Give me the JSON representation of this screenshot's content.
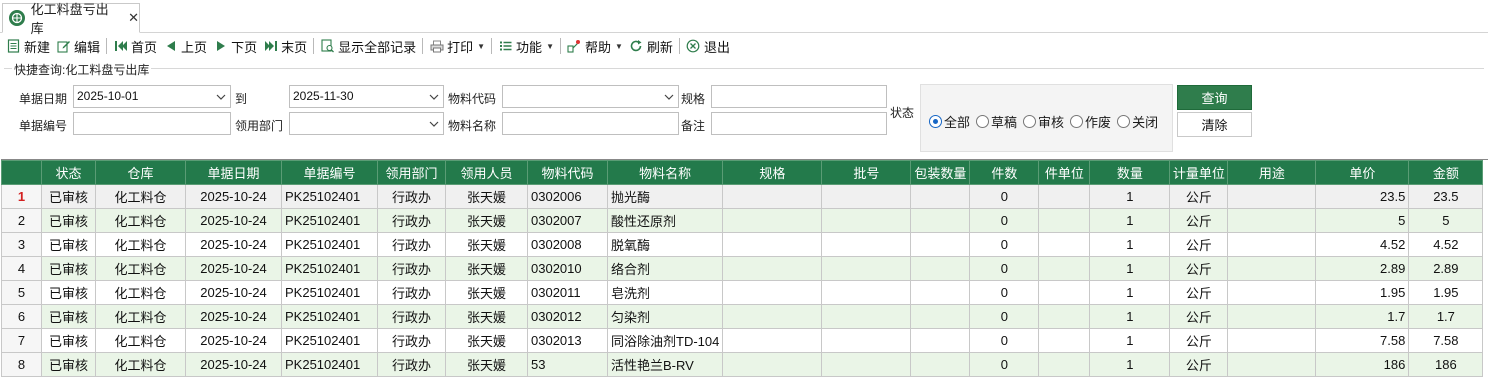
{
  "tab": {
    "label": "化工料盘亏出库",
    "close": "✕"
  },
  "toolbar": {
    "new": "新建",
    "edit": "编辑",
    "first": "首页",
    "prev": "上页",
    "next": "下页",
    "last": "末页",
    "show_all": "显示全部记录",
    "print": "打印",
    "function": "功能",
    "help": "帮助",
    "refresh": "刷新",
    "exit": "退出"
  },
  "query": {
    "title": "快捷查询:化工料盘亏出库",
    "date_label": "单据日期",
    "date_from": "2025-10-01",
    "to_label": "到",
    "date_to": "2025-11-30",
    "material_code_label": "物料代码",
    "material_code": "",
    "spec_label": "规格",
    "spec": "",
    "doc_no_label": "单据编号",
    "doc_no": "",
    "dept_label": "领用部门",
    "dept": "",
    "material_name_label": "物料名称",
    "material_name": "",
    "remark_label": "备注",
    "remark": "",
    "status_label": "状态",
    "status_options": [
      "全部",
      "草稿",
      "审核",
      "作废",
      "关闭"
    ],
    "status_selected": "全部",
    "query_button": "查询",
    "clear_button": "清除"
  },
  "colors": {
    "header_green": "#237a4b",
    "stripe": "#eaf5e7",
    "accent_blue": "#1666c5"
  },
  "grid": {
    "columns": [
      "状态",
      "仓库",
      "单据日期",
      "单据编号",
      "领用部门",
      "领用人员",
      "物料代码",
      "物料名称",
      "规格",
      "批号",
      "包装数量",
      "件数",
      "件单位",
      "数量",
      "计量单位",
      "用途",
      "单价",
      "金额"
    ],
    "rows": [
      [
        "1",
        "已审核",
        "化工料仓",
        "2025-10-24",
        "PK25102401",
        "行政办",
        "张天媛",
        "0302006",
        "抛光酶",
        "",
        "",
        "",
        "0",
        "",
        "1",
        "公斤",
        "",
        "23.5",
        "23.5"
      ],
      [
        "2",
        "已审核",
        "化工料仓",
        "2025-10-24",
        "PK25102401",
        "行政办",
        "张天媛",
        "0302007",
        "酸性还原剂",
        "",
        "",
        "",
        "0",
        "",
        "1",
        "公斤",
        "",
        "5",
        "5"
      ],
      [
        "3",
        "已审核",
        "化工料仓",
        "2025-10-24",
        "PK25102401",
        "行政办",
        "张天媛",
        "0302008",
        "脱氧酶",
        "",
        "",
        "",
        "0",
        "",
        "1",
        "公斤",
        "",
        "4.52",
        "4.52"
      ],
      [
        "4",
        "已审核",
        "化工料仓",
        "2025-10-24",
        "PK25102401",
        "行政办",
        "张天媛",
        "0302010",
        "络合剂",
        "",
        "",
        "",
        "0",
        "",
        "1",
        "公斤",
        "",
        "2.89",
        "2.89"
      ],
      [
        "5",
        "已审核",
        "化工料仓",
        "2025-10-24",
        "PK25102401",
        "行政办",
        "张天媛",
        "0302011",
        "皂洗剂",
        "",
        "",
        "",
        "0",
        "",
        "1",
        "公斤",
        "",
        "1.95",
        "1.95"
      ],
      [
        "6",
        "已审核",
        "化工料仓",
        "2025-10-24",
        "PK25102401",
        "行政办",
        "张天媛",
        "0302012",
        "匀染剂",
        "",
        "",
        "",
        "0",
        "",
        "1",
        "公斤",
        "",
        "1.7",
        "1.7"
      ],
      [
        "7",
        "已审核",
        "化工料仓",
        "2025-10-24",
        "PK25102401",
        "行政办",
        "张天媛",
        "0302013",
        "同浴除油剂TD-104",
        "",
        "",
        "",
        "0",
        "",
        "1",
        "公斤",
        "",
        "7.58",
        "7.58"
      ],
      [
        "8",
        "已审核",
        "化工料仓",
        "2025-10-24",
        "PK25102401",
        "行政办",
        "张天媛",
        "53",
        "活性艳兰B-RV",
        "",
        "",
        "",
        "0",
        "",
        "1",
        "公斤",
        "",
        "186",
        "186"
      ]
    ],
    "selected_row": 0
  }
}
